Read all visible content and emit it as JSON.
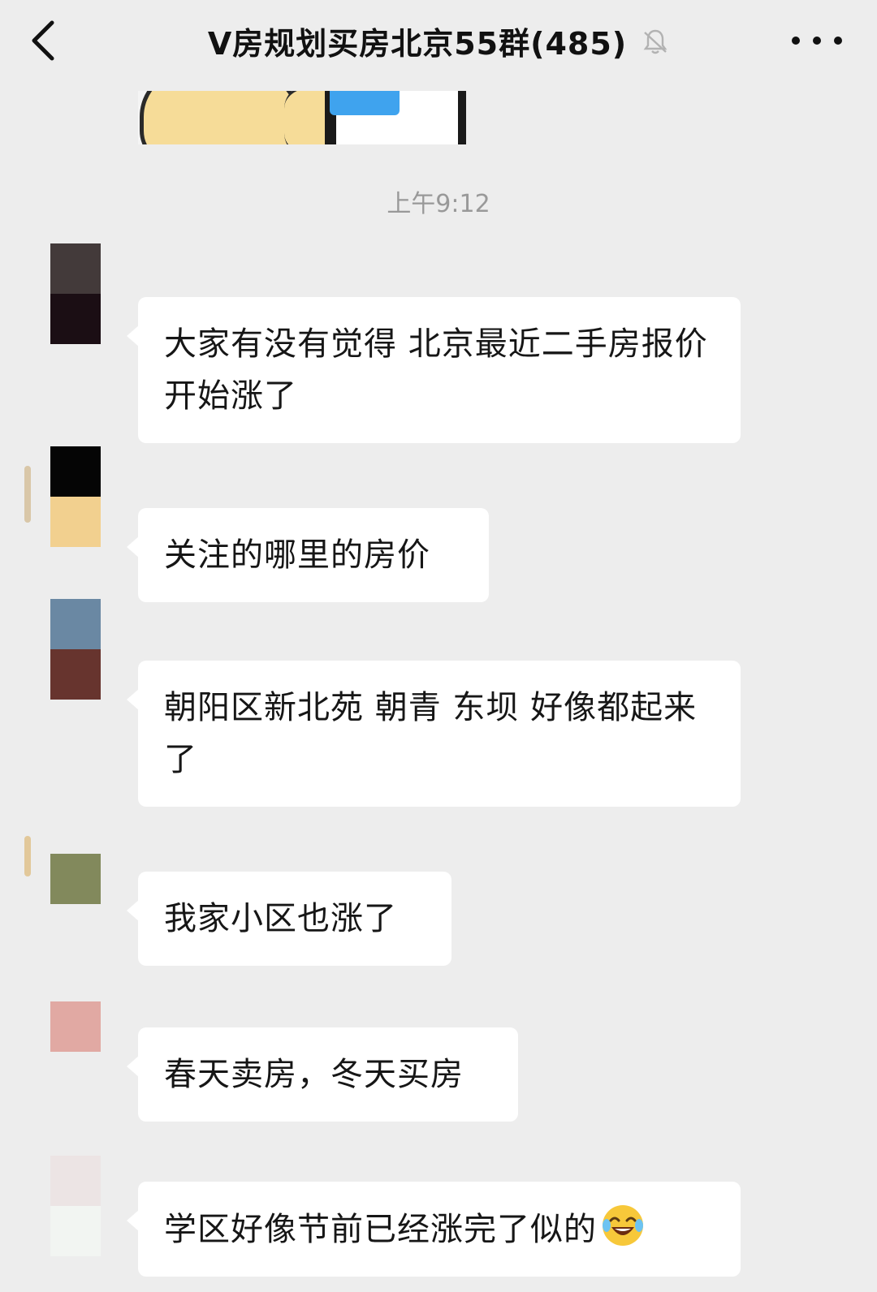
{
  "header": {
    "title": "V房规划买房北京55群(485)",
    "back_icon": "chevron-left-icon",
    "mute_icon": "bell-muted-icon",
    "more_icon": "more-dots-icon"
  },
  "timestamp": "上午9:12",
  "messages": [
    {
      "text": "大家有没有觉得 北京最近二手房报价开始涨了",
      "avatar_colors": [
        "#433a3a",
        "#1b0e14"
      ]
    },
    {
      "text": "关注的哪里的房价",
      "avatar_colors": [
        "#050505",
        "#f2d08f"
      ]
    },
    {
      "text": "朝阳区新北苑 朝青 东坝 好像都起来了",
      "avatar_colors": [
        "#6a88a3",
        "#67342e"
      ]
    },
    {
      "text": "我家小区也涨了",
      "avatar_colors": [
        "#82895c",
        "#82895c"
      ]
    },
    {
      "text": "春天卖房，冬天买房",
      "avatar_colors": [
        "#e1a9a3",
        "#e1a9a3"
      ]
    },
    {
      "text": "学区好像节前已经涨完了似的",
      "emoji": "laughing-tears-emoji",
      "avatar_colors": [
        "#e8e0e0",
        "#f2f5f2"
      ]
    }
  ]
}
